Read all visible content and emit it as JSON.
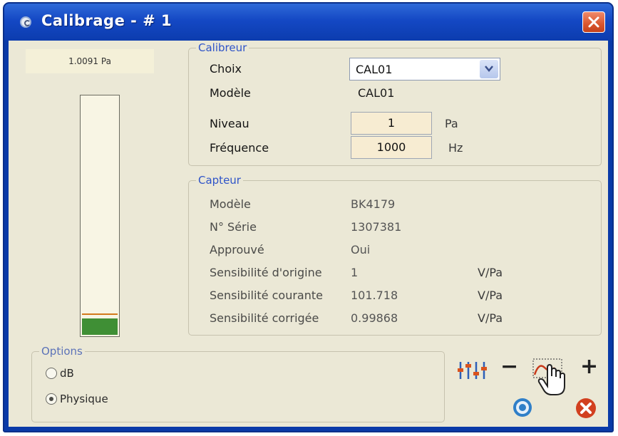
{
  "window": {
    "title": "Calibrage - # 1",
    "icon": "app-logo-icon",
    "close_icon": "close-icon"
  },
  "meter": {
    "readout": "1.0091 Pa",
    "level_fraction": 0.07,
    "marker_fraction": 0.085,
    "fill_color": "#3f8f35"
  },
  "calibreur": {
    "title": "Calibreur",
    "choix_label": "Choix",
    "choix_value": "CAL01",
    "modele_label": "Modèle",
    "modele_value": "CAL01",
    "niveau_label": "Niveau",
    "niveau_value": "1",
    "niveau_unit": "Pa",
    "frequence_label": "Fréquence",
    "frequence_value": "1000",
    "frequence_unit": "Hz"
  },
  "capteur": {
    "title": "Capteur",
    "rows": [
      {
        "label": "Modèle",
        "value": "BK4179",
        "unit": ""
      },
      {
        "label": "N° Série",
        "value": "1307381",
        "unit": ""
      },
      {
        "label": "Approuvé",
        "value": "Oui",
        "unit": ""
      },
      {
        "label": "Sensibilité d'origine",
        "value": "1",
        "unit": "V/Pa"
      },
      {
        "label": "Sensibilité courante",
        "value": "101.718",
        "unit": "V/Pa"
      },
      {
        "label": "Sensibilité corrigée",
        "value": "0.99868",
        "unit": "V/Pa"
      }
    ]
  },
  "options": {
    "title": "Options",
    "choices": [
      {
        "label": "dB",
        "selected": false
      },
      {
        "label": "Physique",
        "selected": true
      }
    ]
  },
  "toolbar": {
    "minus": "−",
    "plus": "+",
    "icons": [
      "sliders-icon",
      "calibrate-hand-icon",
      "eye-icon",
      "cancel-icon"
    ]
  },
  "colors": {
    "titlebar": "#1448c4",
    "group_title": "#2f54c8",
    "cancel": "#d2401f",
    "eye": "#2f7fc8"
  }
}
